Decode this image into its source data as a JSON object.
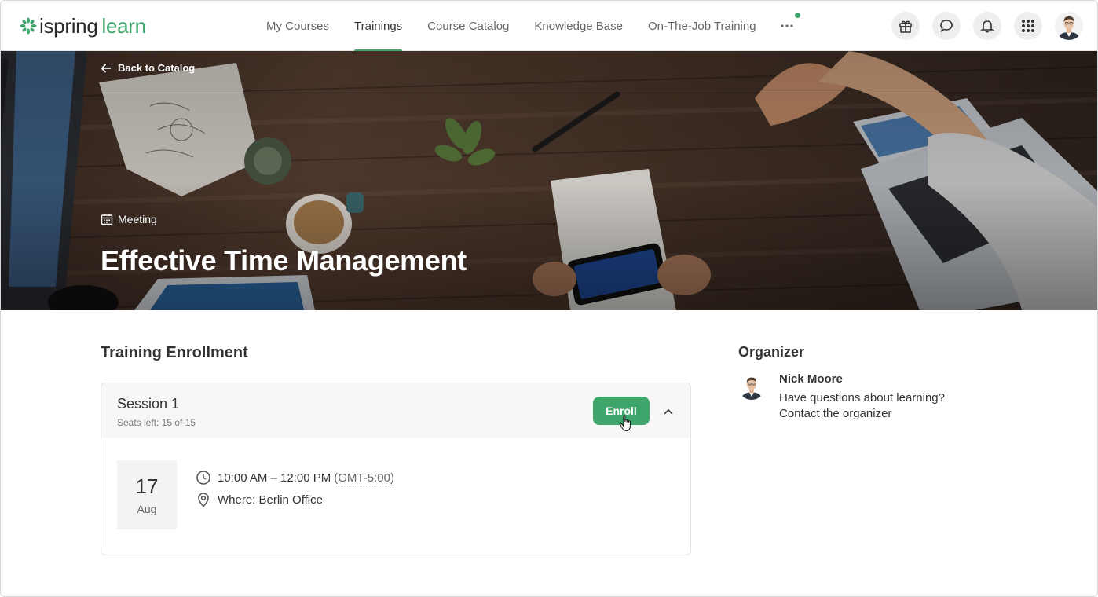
{
  "app": {
    "logo_word1": "ispring",
    "logo_word2": "learn",
    "brand_color": "#3fa66b"
  },
  "nav": {
    "items": [
      {
        "label": "My Courses",
        "active": false
      },
      {
        "label": "Trainings",
        "active": true
      },
      {
        "label": "Course Catalog",
        "active": false
      },
      {
        "label": "Knowledge Base",
        "active": false
      },
      {
        "label": "On-The-Job Training",
        "active": false
      }
    ],
    "more_label": "···"
  },
  "header_icons": [
    "gift-icon",
    "chat-icon",
    "bell-icon",
    "apps-grid-icon",
    "user-avatar"
  ],
  "hero": {
    "back_label": "Back to Catalog",
    "type_label": "Meeting",
    "title": "Effective Time Management"
  },
  "enrollment": {
    "section_title": "Training Enrollment",
    "session": {
      "name": "Session 1",
      "seats": "Seats left: 15 of 15",
      "enroll_label": "Enroll",
      "date_day": "17",
      "date_month": "Aug",
      "time": "10:00 AM – 12:00 PM",
      "timezone": "(GMT-5:00)",
      "where": "Where: Berlin Office"
    }
  },
  "organizer": {
    "title": "Organizer",
    "name": "Nick Moore",
    "question": "Have questions about learning?",
    "contact_label": "Contact the organizer"
  }
}
